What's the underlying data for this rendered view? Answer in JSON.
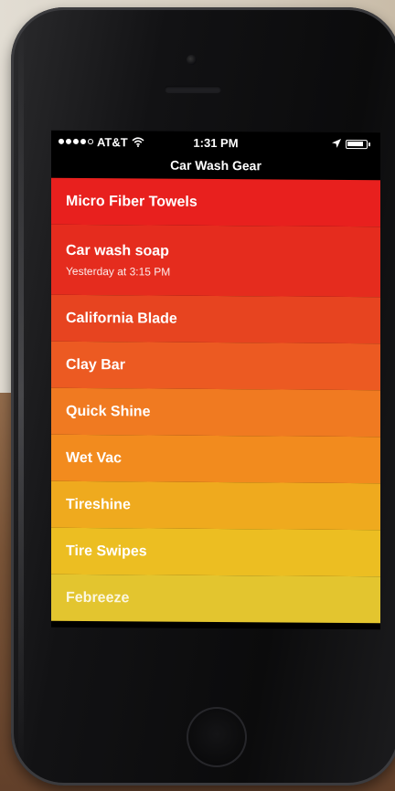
{
  "status_bar": {
    "carrier": "AT&T",
    "time": "1:31 PM"
  },
  "nav": {
    "title": "Car Wash Gear"
  },
  "list": {
    "items": [
      {
        "title": "Micro Fiber Towels",
        "subtitle": ""
      },
      {
        "title": "Car wash soap",
        "subtitle": "Yesterday at 3:15 PM"
      },
      {
        "title": "California Blade",
        "subtitle": ""
      },
      {
        "title": "Clay Bar",
        "subtitle": ""
      },
      {
        "title": "Quick Shine",
        "subtitle": ""
      },
      {
        "title": "Wet Vac",
        "subtitle": ""
      },
      {
        "title": "Tireshine",
        "subtitle": ""
      },
      {
        "title": "Tire Swipes",
        "subtitle": ""
      },
      {
        "title": "Febreeze",
        "subtitle": ""
      }
    ]
  },
  "colors": {
    "top_row": "#e8201e",
    "bottom_row": "#e3c52f"
  }
}
